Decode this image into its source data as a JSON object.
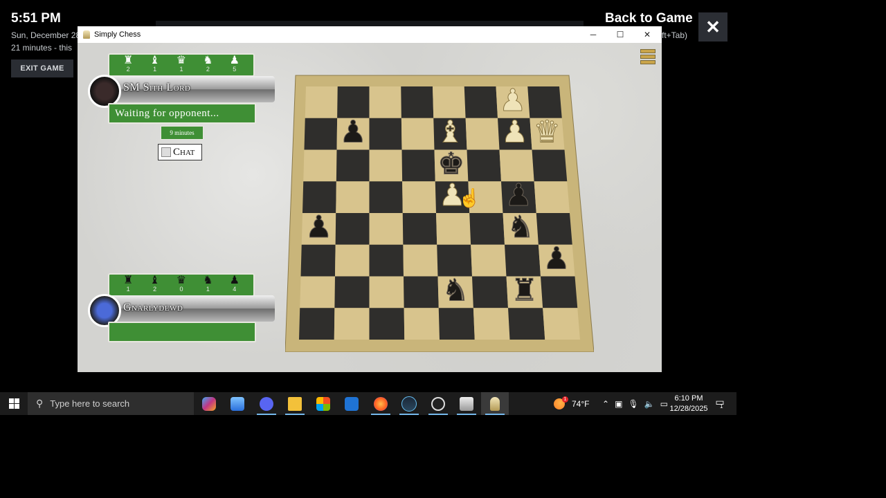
{
  "overlay": {
    "clock": "5:51 PM",
    "date": "Sun, December 28",
    "played": "21 minutes - this",
    "exit_label": "EXIT GAME",
    "back_title": "Back to Game",
    "back_hint": "ft+Tab)"
  },
  "window": {
    "title": "Simply Chess",
    "minimize": "─",
    "maximize": "☐",
    "close": "✕"
  },
  "opponent": {
    "name": "SM Sith Lord",
    "status": "Waiting for opponent...",
    "timer": "9 minutes",
    "chat_label": "Chat",
    "captured": [
      {
        "glyph": "♜",
        "count": "2"
      },
      {
        "glyph": "♝",
        "count": "1"
      },
      {
        "glyph": "♛",
        "count": "1"
      },
      {
        "glyph": "♞",
        "count": "2"
      },
      {
        "glyph": "♟",
        "count": "5"
      }
    ]
  },
  "player": {
    "name": "Gnarlydewd",
    "captured": [
      {
        "glyph": "♜",
        "count": "1"
      },
      {
        "glyph": "♝",
        "count": "2"
      },
      {
        "glyph": "♛",
        "count": "0"
      },
      {
        "glyph": "♞",
        "count": "1"
      },
      {
        "glyph": "♟",
        "count": "4"
      }
    ]
  },
  "board": {
    "pieces": [
      {
        "file": 6,
        "rank": 0,
        "color": "white",
        "type": "pawn"
      },
      {
        "file": 7,
        "rank": 1,
        "color": "white",
        "type": "queen"
      },
      {
        "file": 1,
        "rank": 1,
        "color": "black",
        "type": "pawn"
      },
      {
        "file": 4,
        "rank": 1,
        "color": "white",
        "type": "bishop"
      },
      {
        "file": 6,
        "rank": 1,
        "color": "white",
        "type": "pawn"
      },
      {
        "file": 4,
        "rank": 2,
        "color": "black",
        "type": "king"
      },
      {
        "file": 4,
        "rank": 3,
        "color": "white",
        "type": "pawn"
      },
      {
        "file": 6,
        "rank": 3,
        "color": "black",
        "type": "pawn"
      },
      {
        "file": 6,
        "rank": 4,
        "color": "black",
        "type": "knight"
      },
      {
        "file": 0,
        "rank": 4,
        "color": "black",
        "type": "pawn"
      },
      {
        "file": 7,
        "rank": 5,
        "color": "black",
        "type": "pawn"
      },
      {
        "file": 4,
        "rank": 6,
        "color": "black",
        "type": "knight"
      },
      {
        "file": 6,
        "rank": 6,
        "color": "black",
        "type": "rook"
      }
    ]
  },
  "taskbar": {
    "search_placeholder": "Type here to search",
    "weather": "74°F",
    "weather_badge": "1",
    "time": "6:10 PM",
    "date": "12/28/2025",
    "notif_count": "1"
  }
}
